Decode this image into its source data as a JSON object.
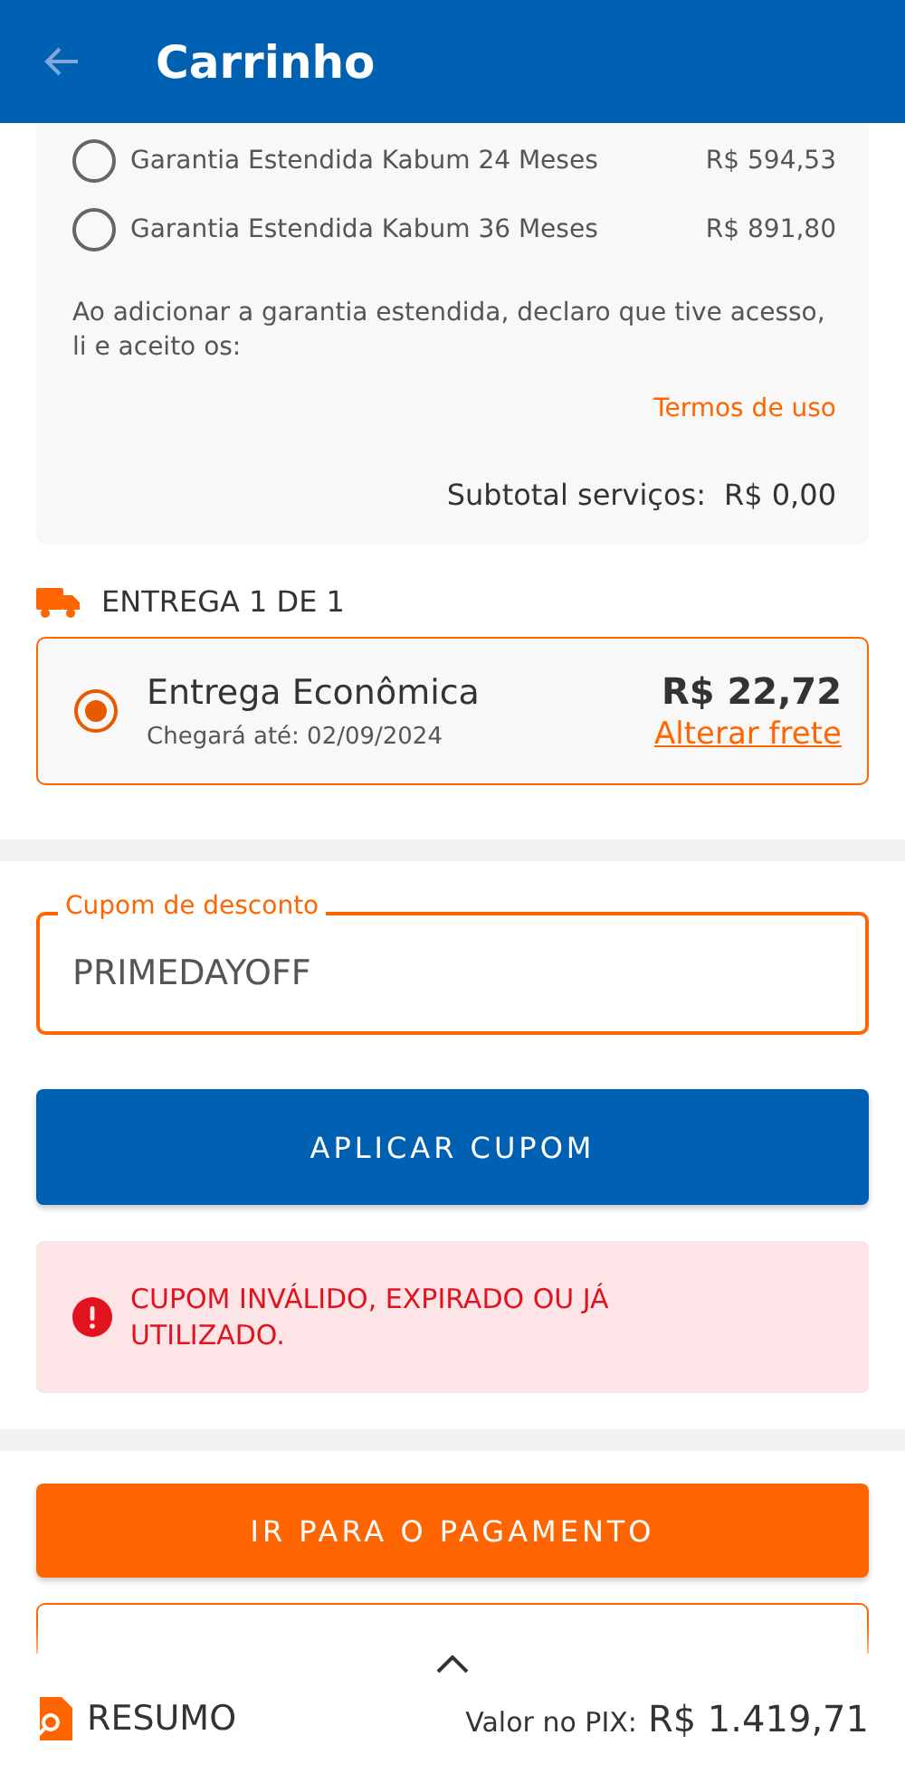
{
  "header": {
    "title": "Carrinho"
  },
  "warranty": {
    "options": [
      {
        "label": "Garantia Estendida Kabum 24 Meses",
        "price": "R$ 594,53",
        "selected": false
      },
      {
        "label": "Garantia Estendida Kabum 36 Meses",
        "price": "R$ 891,80",
        "selected": false
      }
    ],
    "notice": "Ao adicionar a garantia estendida, declaro que tive acesso, li e aceito os:",
    "terms_link": "Termos de uso",
    "subtotal_label": "Subtotal serviços:",
    "subtotal_value": "R$ 0,00"
  },
  "delivery": {
    "heading": "ENTREGA 1 DE 1",
    "option": {
      "name": "Entrega Econômica",
      "eta": "Chegará até: 02/09/2024",
      "price": "R$ 22,72",
      "change_link": "Alterar frete",
      "selected": true
    }
  },
  "coupon": {
    "label": "Cupom de desconto",
    "value": "PRIMEDAYOFF",
    "apply_button": "APLICAR CUPOM",
    "error": "CUPOM INVÁLIDO, EXPIRADO OU JÁ UTILIZADO."
  },
  "pay_button": "IR PARA O PAGAMENTO",
  "summary_bar": {
    "label": "RESUMO",
    "pix_label": "Valor no PIX:",
    "pix_value": "R$ 1.419,71"
  }
}
